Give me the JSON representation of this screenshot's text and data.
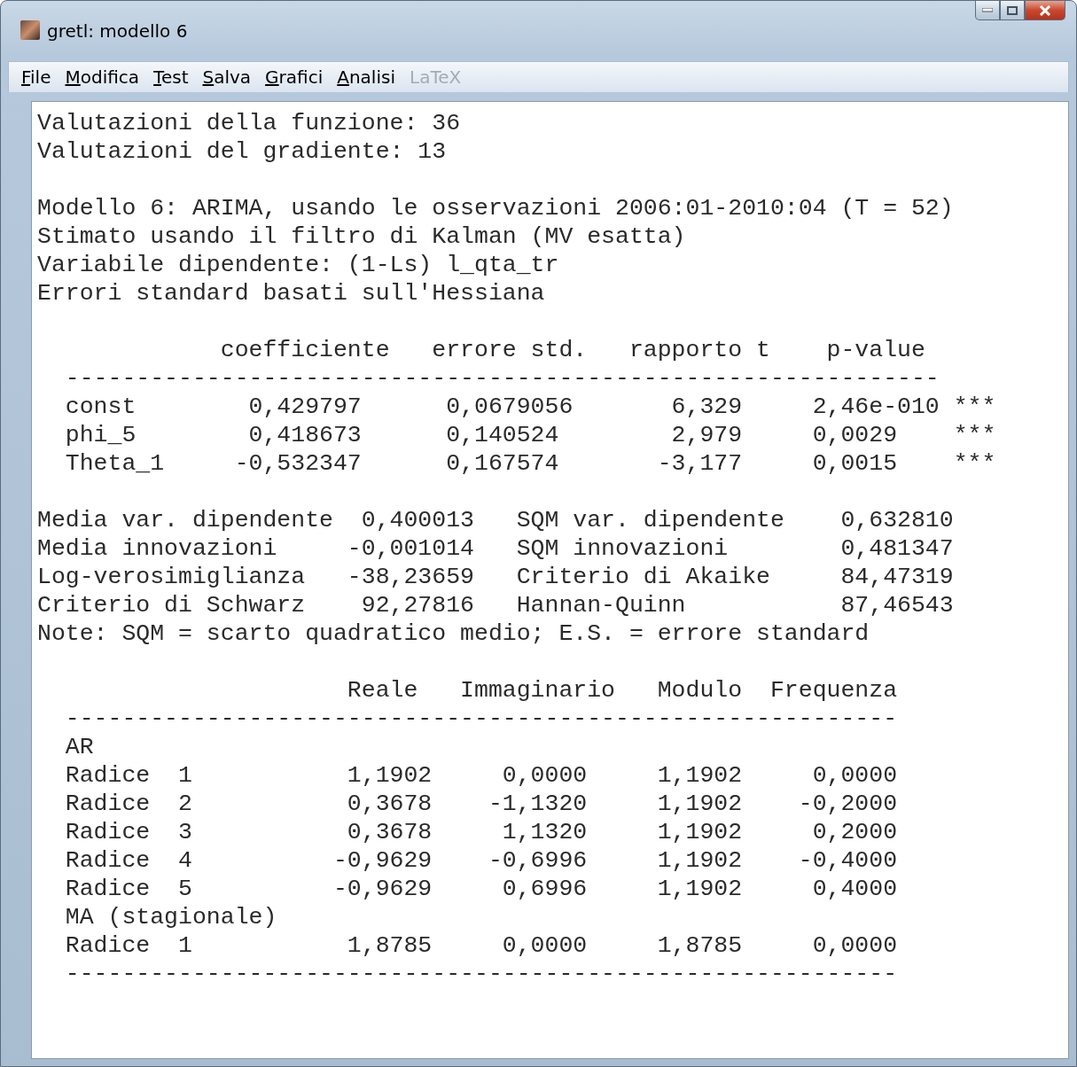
{
  "window": {
    "title": "gretl: modello 6"
  },
  "menu": [
    {
      "label": "File",
      "disabled": false
    },
    {
      "label": "Modifica",
      "disabled": false
    },
    {
      "label": "Test",
      "disabled": false
    },
    {
      "label": "Salva",
      "disabled": false
    },
    {
      "label": "Grafici",
      "disabled": false
    },
    {
      "label": "Analisi",
      "disabled": false
    },
    {
      "label": "LaTeX",
      "disabled": true
    }
  ],
  "output": {
    "blocks": [
      [
        "Valutazioni della funzione: 36",
        "Valutazioni del gradiente: 13"
      ],
      [
        "Modello 6: ARIMA, usando le osservazioni 2006:01-2010:04 (T = 52)",
        "Stimato usando il filtro di Kalman (MV esatta)",
        "Variabile dipendente: (1-Ls) l_qta_tr",
        "Errori standard basati sull'Hessiana"
      ],
      [
        "             coefficiente   errore std.   rapporto t    p-value",
        "  --------------------------------------------------------------",
        "  const        0,429797      0,0679056       6,329     2,46e-010 ***",
        "  phi_5        0,418673      0,140524        2,979     0,0029    ***",
        "  Theta_1     -0,532347      0,167574       -3,177     0,0015    ***"
      ],
      [
        "Media var. dipendente  0,400013   SQM var. dipendente    0,632810",
        "Media innovazioni     -0,001014   SQM innovazioni        0,481347",
        "Log-verosimiglianza   -38,23659   Criterio di Akaike     84,47319",
        "Criterio di Schwarz    92,27816   Hannan-Quinn           87,46543",
        "Note: SQM = scarto quadratico medio; E.S. = errore standard"
      ],
      [
        "                      Reale   Immaginario   Modulo  Frequenza",
        "  -----------------------------------------------------------",
        "  AR",
        "  Radice  1           1,1902     0,0000     1,1902     0,0000",
        "  Radice  2           0,3678    -1,1320     1,1902    -0,2000",
        "  Radice  3           0,3678     1,1320     1,1902     0,2000",
        "  Radice  4          -0,9629    -0,6996     1,1902    -0,4000",
        "  Radice  5          -0,9629     0,6996     1,1902     0,4000",
        "  MA (stagionale)",
        "  Radice  1           1,8785     0,0000     1,8785     0,0000",
        "  -----------------------------------------------------------"
      ]
    ]
  }
}
